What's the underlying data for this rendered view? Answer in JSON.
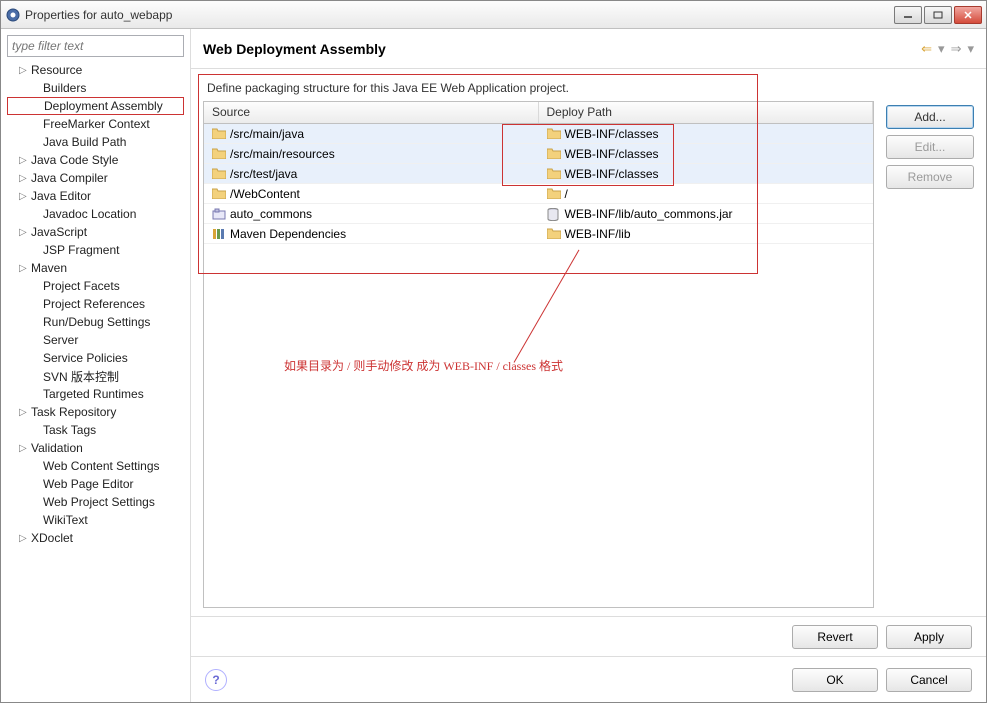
{
  "window": {
    "title": "Properties for auto_webapp"
  },
  "sidebar": {
    "filter_placeholder": "type filter text",
    "items": [
      {
        "label": "Resource",
        "expandable": true
      },
      {
        "label": "Builders"
      },
      {
        "label": "Deployment Assembly",
        "selected": true
      },
      {
        "label": "FreeMarker Context"
      },
      {
        "label": "Java Build Path"
      },
      {
        "label": "Java Code Style",
        "expandable": true
      },
      {
        "label": "Java Compiler",
        "expandable": true
      },
      {
        "label": "Java Editor",
        "expandable": true
      },
      {
        "label": "Javadoc Location"
      },
      {
        "label": "JavaScript",
        "expandable": true
      },
      {
        "label": "JSP Fragment"
      },
      {
        "label": "Maven",
        "expandable": true
      },
      {
        "label": "Project Facets"
      },
      {
        "label": "Project References"
      },
      {
        "label": "Run/Debug Settings"
      },
      {
        "label": "Server"
      },
      {
        "label": "Service Policies"
      },
      {
        "label": "SVN 版本控制"
      },
      {
        "label": "Targeted Runtimes"
      },
      {
        "label": "Task Repository",
        "expandable": true
      },
      {
        "label": "Task Tags"
      },
      {
        "label": "Validation",
        "expandable": true
      },
      {
        "label": "Web Content Settings"
      },
      {
        "label": "Web Page Editor"
      },
      {
        "label": "Web Project Settings"
      },
      {
        "label": "WikiText"
      },
      {
        "label": "XDoclet",
        "expandable": true
      }
    ]
  },
  "page": {
    "title": "Web Deployment Assembly",
    "description": "Define packaging structure for this Java EE Web Application project.",
    "columns": {
      "source": "Source",
      "deploy": "Deploy Path"
    },
    "rows": [
      {
        "source": "/src/main/java",
        "deploy": "WEB-INF/classes",
        "icon": "folder",
        "dicon": "folder",
        "sel": true
      },
      {
        "source": "/src/main/resources",
        "deploy": "WEB-INF/classes",
        "icon": "folder",
        "dicon": "folder",
        "sel": true
      },
      {
        "source": "/src/test/java",
        "deploy": "WEB-INF/classes",
        "icon": "folder",
        "dicon": "folder",
        "sel": true
      },
      {
        "source": "/WebContent",
        "deploy": "/",
        "icon": "folder",
        "dicon": "folder"
      },
      {
        "source": "auto_commons",
        "deploy": "WEB-INF/lib/auto_commons.jar",
        "icon": "project",
        "dicon": "jar"
      },
      {
        "source": "Maven Dependencies",
        "deploy": "WEB-INF/lib",
        "icon": "library",
        "dicon": "folder"
      }
    ],
    "buttons": {
      "add": "Add...",
      "edit": "Edit...",
      "remove": "Remove",
      "revert": "Revert",
      "apply": "Apply",
      "ok": "OK",
      "cancel": "Cancel"
    },
    "annotation": "如果目录为  /  则手动修改 成为 WEB-INF / classes 格式"
  }
}
